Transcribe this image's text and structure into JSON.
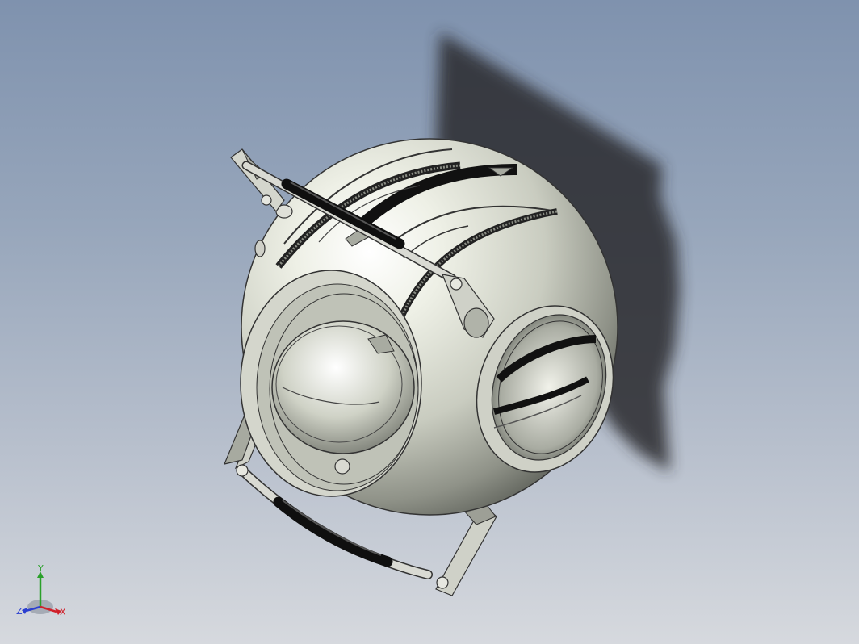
{
  "viewport": {
    "background_top": "#7f92ae",
    "background_bottom": "#d6d9de"
  },
  "model": {
    "name_icon": "spherical-robot-core-model",
    "body_color": "#e9ecdf",
    "shadow_color": "#2b2b2d",
    "rubber_color": "#161616"
  },
  "triad": {
    "x_label": "X",
    "y_label": "Y",
    "z_label": "Z",
    "x_color": "#d0202a",
    "y_color": "#2aa02a",
    "z_color": "#2b3fd0"
  }
}
